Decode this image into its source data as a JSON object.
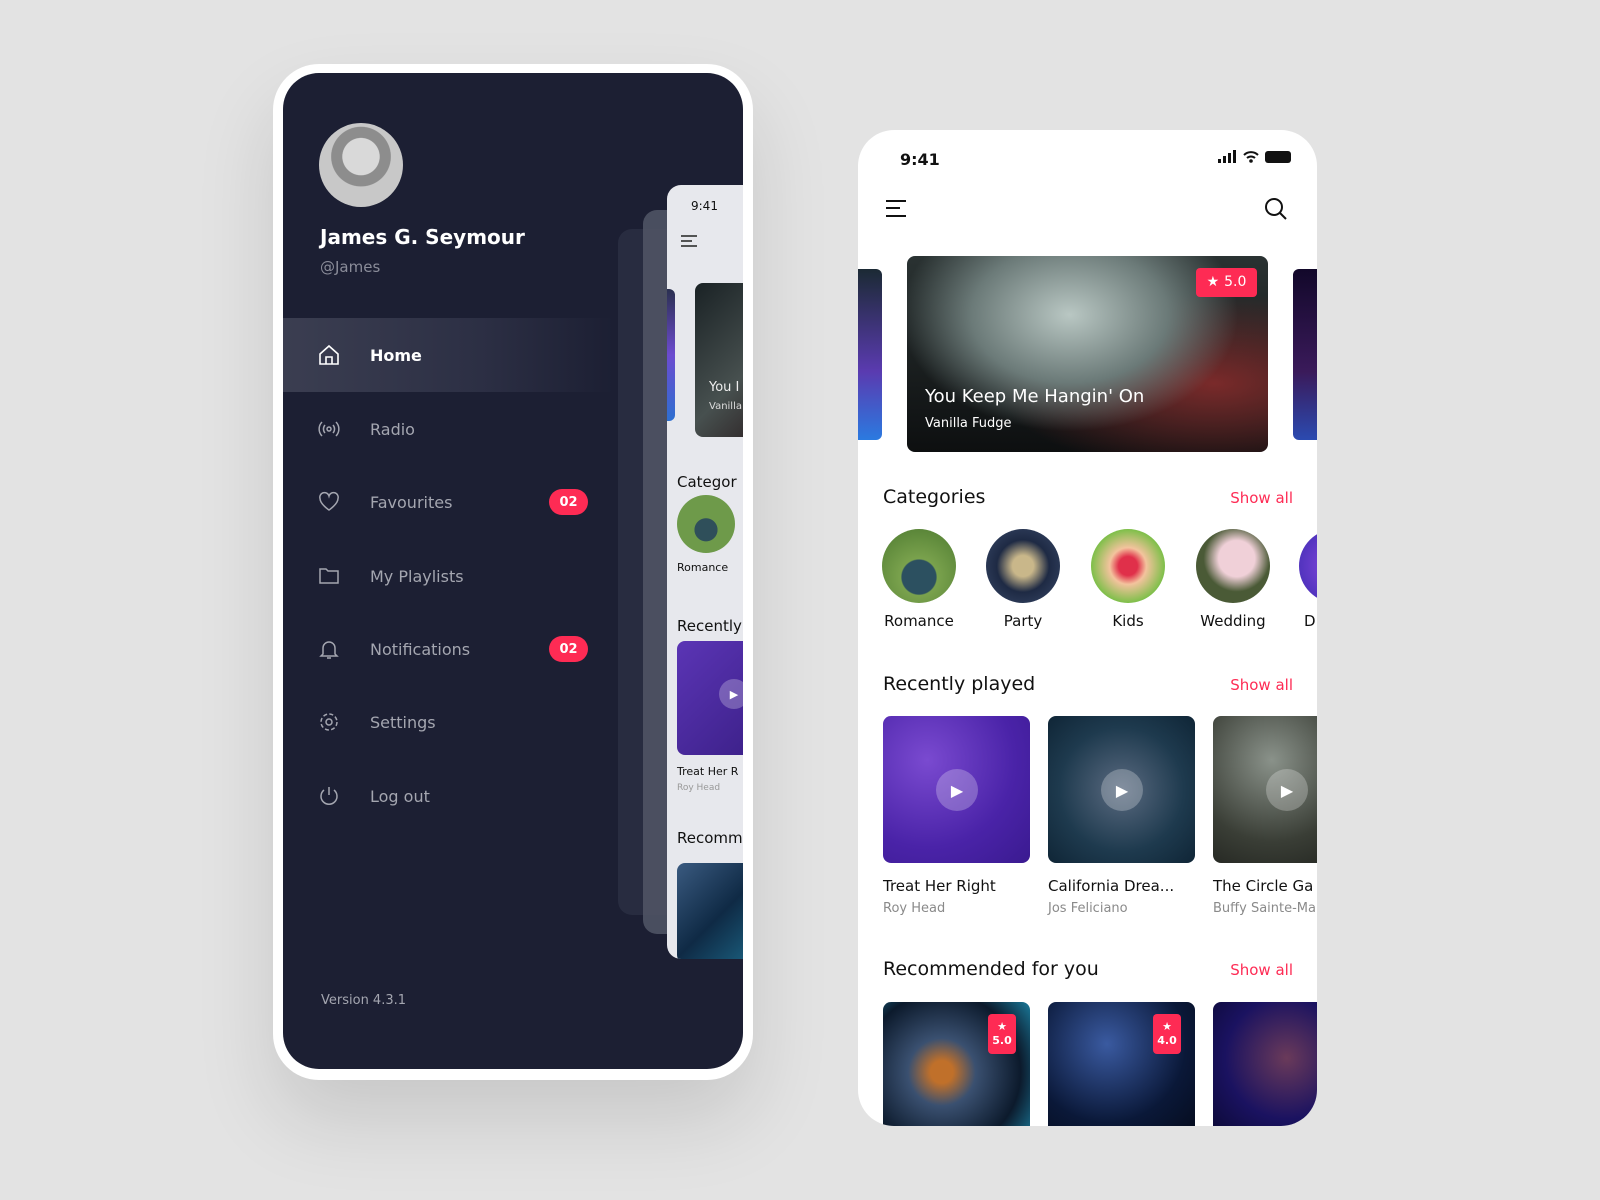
{
  "drawer": {
    "user_name": "James G. Seymour",
    "user_handle": "@James",
    "items": [
      {
        "label": "Home",
        "icon": "home-icon",
        "active": true
      },
      {
        "label": "Radio",
        "icon": "radio-icon"
      },
      {
        "label": "Favourites",
        "icon": "heart-icon",
        "badge": "02"
      },
      {
        "label": "My Playlists",
        "icon": "folder-icon"
      },
      {
        "label": "Notifications",
        "icon": "bell-icon",
        "badge": "02"
      },
      {
        "label": "Settings",
        "icon": "gear-icon"
      },
      {
        "label": "Log out",
        "icon": "power-icon"
      }
    ],
    "version": "Version 4.3.1"
  },
  "preview": {
    "time": "9:41",
    "featured_title": "You I",
    "featured_artist": "Vanilla",
    "categories": "Categor",
    "category_label": "Romance",
    "recently": "Recently",
    "track_title": "Treat Her R",
    "track_artist": "Roy Head",
    "recommended": "Recomm"
  },
  "home": {
    "time": "9:41",
    "featured": {
      "title": "You Keep Me Hangin' On",
      "artist": "Vanilla Fudge",
      "rating": "5.0"
    },
    "categories_title": "Categories",
    "show_all": "Show all",
    "categories": [
      {
        "label": "Romance"
      },
      {
        "label": "Party"
      },
      {
        "label": "Kids"
      },
      {
        "label": "Wedding"
      },
      {
        "label": "D"
      }
    ],
    "recent_title": "Recently played",
    "recent": [
      {
        "title": "Treat Her Right",
        "artist": "Roy Head"
      },
      {
        "title": "California Drea...",
        "artist": "Jos Feliciano"
      },
      {
        "title": "The Circle Ga",
        "artist": "Buffy Sainte-Ma"
      }
    ],
    "recommended_title": "Recommended for you",
    "recommended": [
      {
        "rating": "5.0"
      },
      {
        "rating": "4.0"
      },
      {}
    ]
  },
  "colors": {
    "accent": "#fe2b54",
    "drawer_bg": "#1c1f33"
  }
}
